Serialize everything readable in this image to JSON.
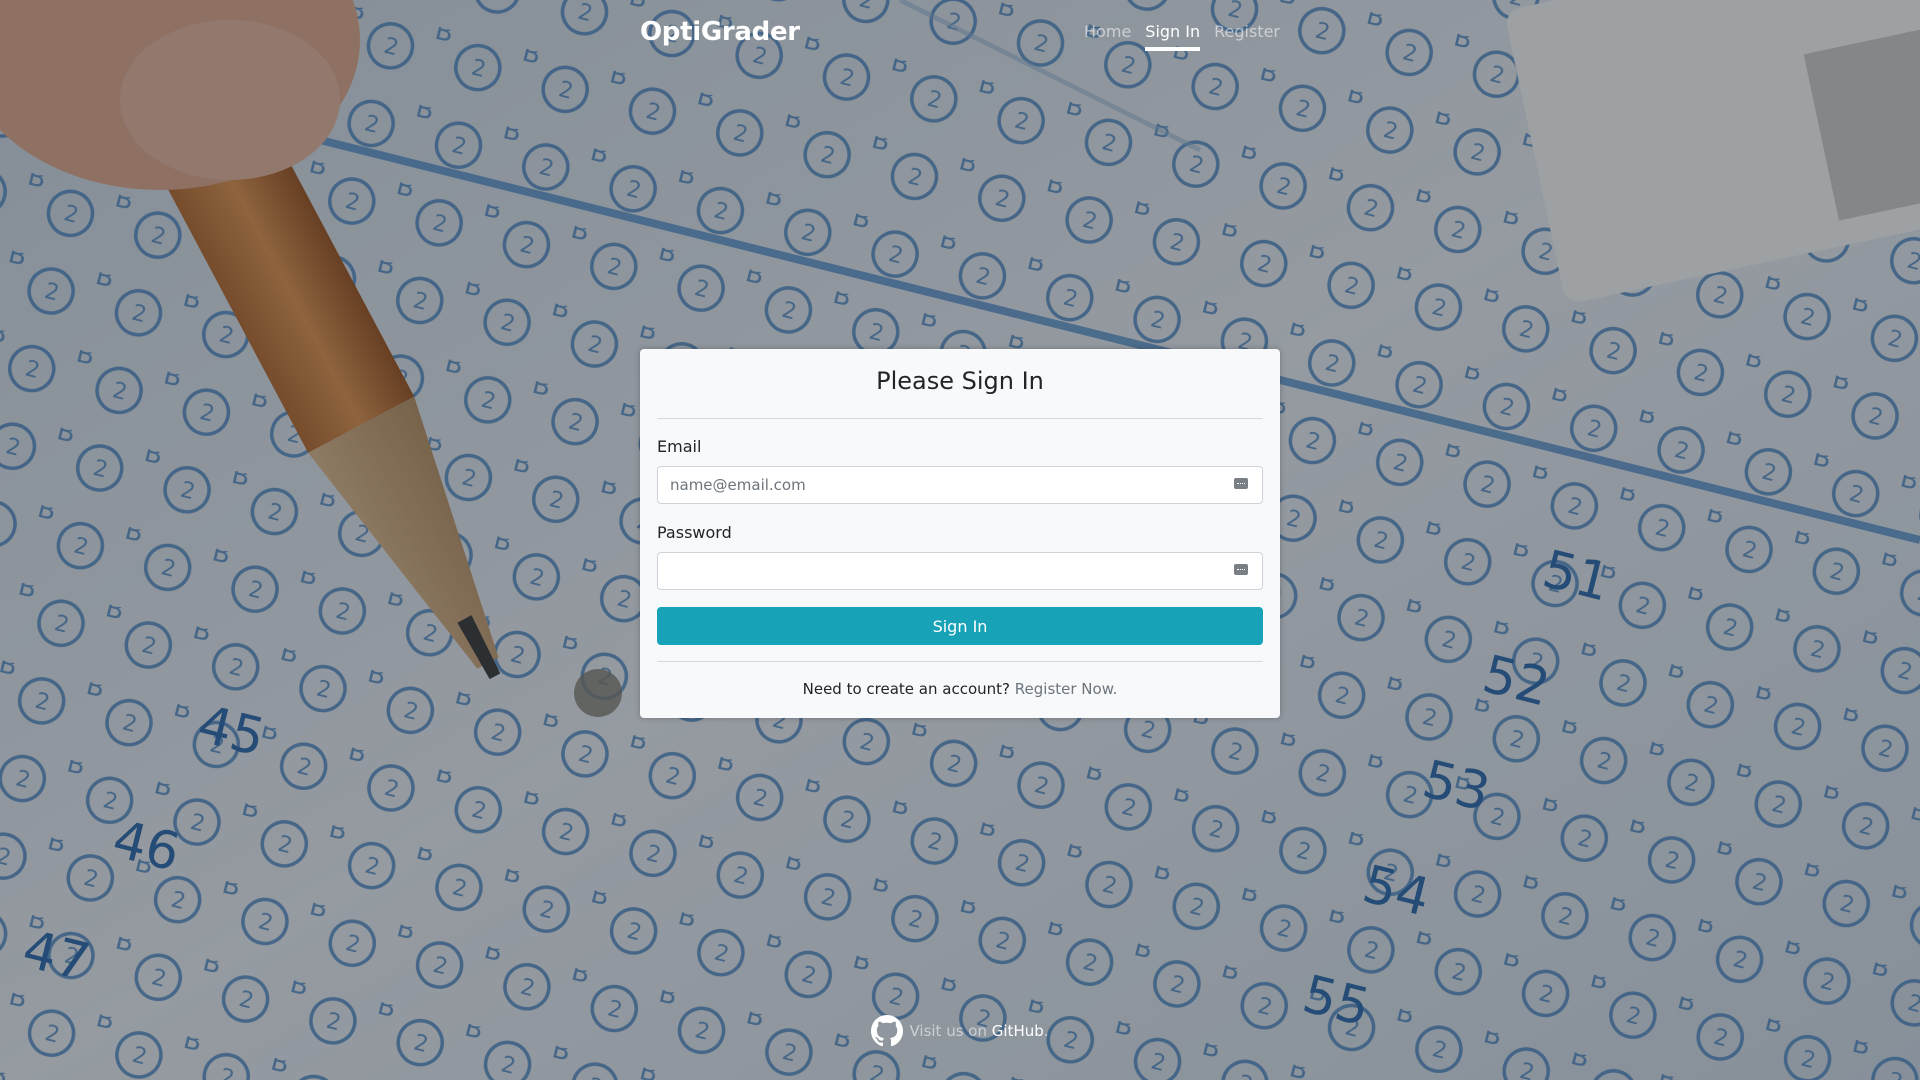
{
  "app": {
    "brand": "OptiGrader"
  },
  "nav": {
    "items": [
      {
        "label": "Home",
        "active": false
      },
      {
        "label": "Sign In",
        "active": true
      },
      {
        "label": "Register",
        "active": false
      }
    ]
  },
  "signin": {
    "title": "Please Sign In",
    "email_label": "Email",
    "email_placeholder": "name@email.com",
    "email_value": "",
    "password_label": "Password",
    "password_value": "",
    "submit_label": "Sign In",
    "prompt_text": "Need to create an account?",
    "register_link": "Register Now."
  },
  "footer": {
    "visit_text": "Visit us on",
    "link_text": "GitHub",
    "suffix": ".",
    "icon": "github-icon"
  },
  "colors": {
    "primary_button": "#17a2b8",
    "card_background": "#f8f9fa",
    "nav_active": "#ffffff"
  },
  "background": {
    "description": "answer-sheet-with-pencil"
  }
}
